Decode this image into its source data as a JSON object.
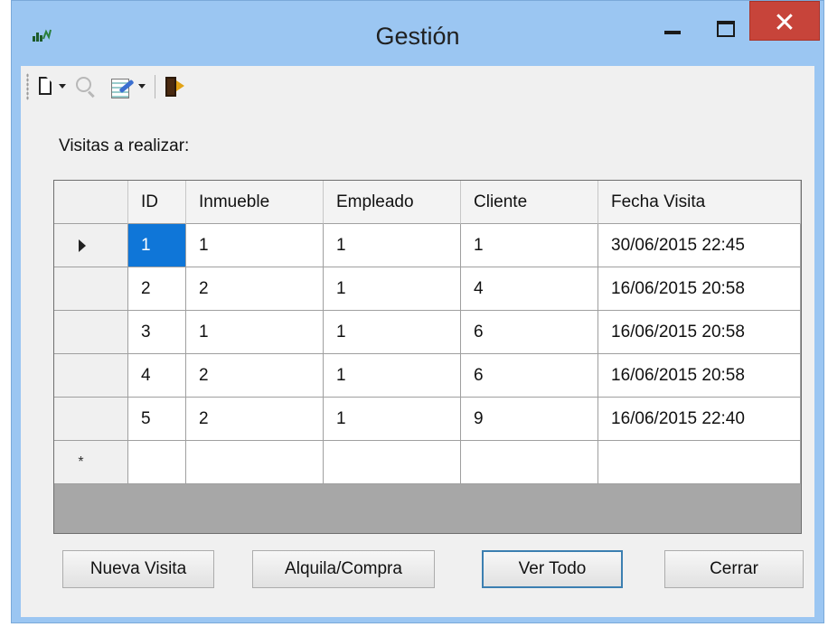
{
  "window": {
    "title": "Gestión"
  },
  "toolbar": {
    "items": [
      "new-document",
      "search",
      "edit",
      "exit"
    ]
  },
  "section_label": "Visitas a realizar:",
  "grid": {
    "columns": [
      "ID",
      "Inmueble",
      "Empleado",
      "Cliente",
      "Fecha Visita"
    ],
    "rows": [
      [
        "1",
        "1",
        "1",
        "1",
        "30/06/2015 22:45"
      ],
      [
        "2",
        "2",
        "1",
        "4",
        "16/06/2015 20:58"
      ],
      [
        "3",
        "1",
        "1",
        "6",
        "16/06/2015 20:58"
      ],
      [
        "4",
        "2",
        "1",
        "6",
        "16/06/2015 20:58"
      ],
      [
        "5",
        "2",
        "1",
        "9",
        "16/06/2015 22:40"
      ]
    ],
    "selected_cell": {
      "row": 0,
      "column": 0
    },
    "new_row_marker": "*"
  },
  "buttons": {
    "nueva_visita": "Nueva Visita",
    "alquila_compra": "Alquila/Compra",
    "ver_todo": "Ver Todo",
    "cerrar": "Cerrar"
  },
  "colors": {
    "title_bar": "#9bc6f2",
    "close_button": "#c7443a",
    "selection": "#0f76d8",
    "grid_background": "#a7a7a7"
  }
}
